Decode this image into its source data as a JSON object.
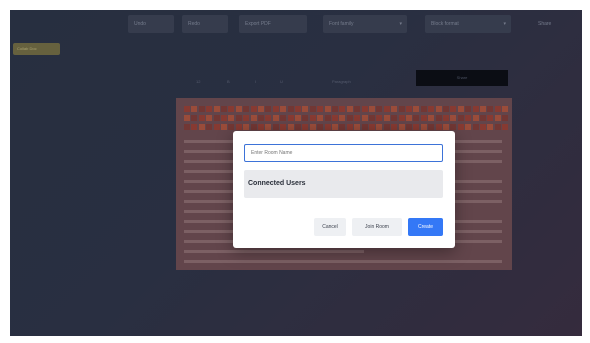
{
  "toolbar": {
    "items": [
      "Undo",
      "Redo",
      "Export PDF",
      "Font family",
      "Block format"
    ],
    "share_label": "Share"
  },
  "sidebar": {
    "tag_label": "Collab Doc"
  },
  "editor_controls": {
    "font_size": "12",
    "bold_label": "B",
    "italic_label": "I",
    "underline_label": "U",
    "paragraph_label": "Paragraph",
    "action_label": "Share"
  },
  "modal": {
    "room_placeholder": "Enter Room Name",
    "connected_users_label": "Connected Users",
    "cancel_label": "Cancel",
    "join_label": "Join Room",
    "create_label": "Create"
  },
  "colors": {
    "accent": "#3478f6",
    "input_border": "#3d73d8",
    "background": "#2d3347"
  }
}
